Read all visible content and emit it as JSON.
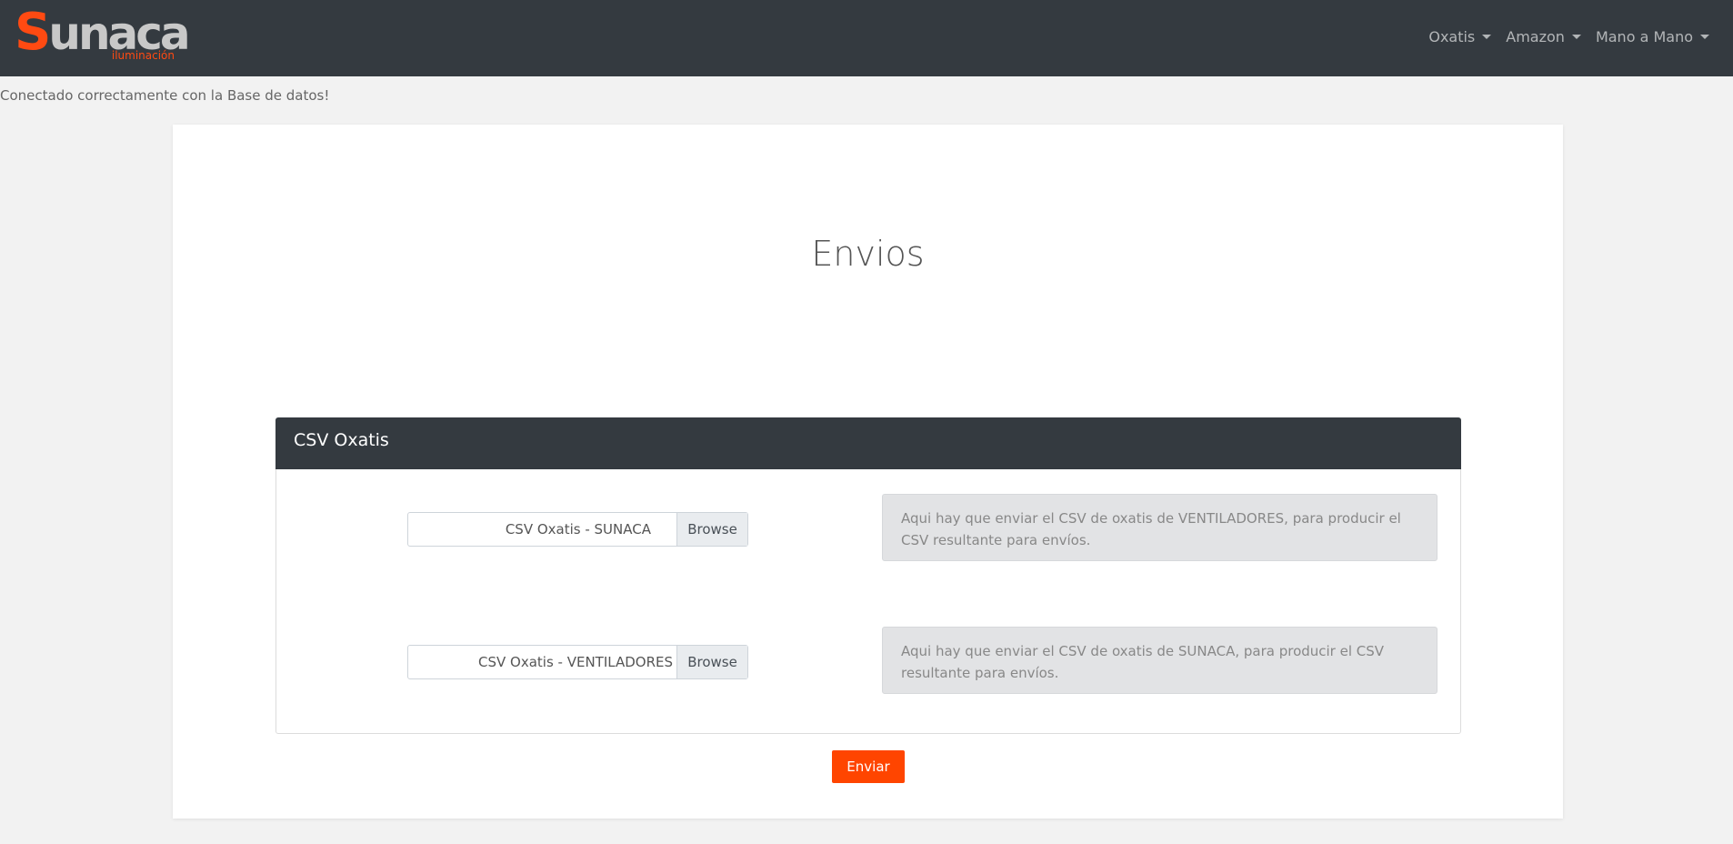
{
  "brand": {
    "logo_initial": "S",
    "logo_rest": "unaca",
    "logo_subtitle": "iluminación"
  },
  "nav": {
    "items": [
      {
        "label": "Oxatis"
      },
      {
        "label": "Amazon"
      },
      {
        "label": "Mano a Mano"
      }
    ]
  },
  "status_message": "Conectado correctamente con la Base de datos!",
  "page": {
    "title": "Envios"
  },
  "panel": {
    "title": "CSV Oxatis",
    "rows": [
      {
        "file_label": "CSV Oxatis - SUNACA",
        "browse_label": "Browse",
        "info": "Aqui hay que enviar el CSV de oxatis de VENTILADORES, para producir el CSV resultante para envíos."
      },
      {
        "file_label": "CSV Oxatis - VENTILADORES",
        "browse_label": "Browse",
        "info": "Aqui hay que enviar el CSV de oxatis de SUNACA, para producir el CSV resultante para envíos."
      }
    ]
  },
  "submit_label": "Enviar",
  "colors": {
    "navbar": "#343a40",
    "accent": "#ff4500",
    "page_background": "#f2f2f2"
  }
}
